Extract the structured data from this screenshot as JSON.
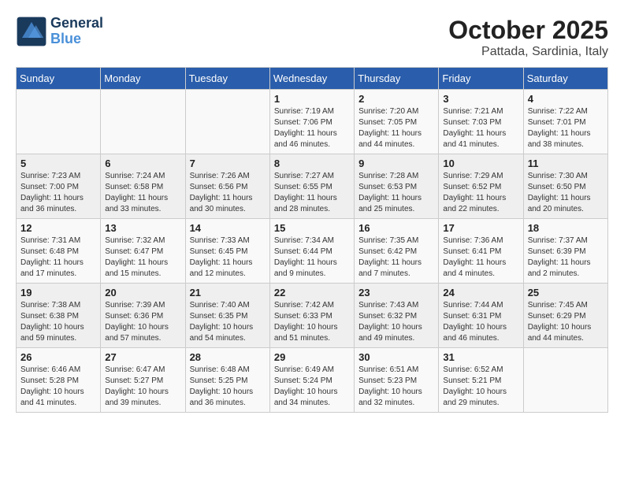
{
  "header": {
    "logo_line1": "General",
    "logo_line2": "Blue",
    "month": "October 2025",
    "location": "Pattada, Sardinia, Italy"
  },
  "weekdays": [
    "Sunday",
    "Monday",
    "Tuesday",
    "Wednesday",
    "Thursday",
    "Friday",
    "Saturday"
  ],
  "weeks": [
    [
      {
        "day": "",
        "info": ""
      },
      {
        "day": "",
        "info": ""
      },
      {
        "day": "",
        "info": ""
      },
      {
        "day": "1",
        "info": "Sunrise: 7:19 AM\nSunset: 7:06 PM\nDaylight: 11 hours\nand 46 minutes."
      },
      {
        "day": "2",
        "info": "Sunrise: 7:20 AM\nSunset: 7:05 PM\nDaylight: 11 hours\nand 44 minutes."
      },
      {
        "day": "3",
        "info": "Sunrise: 7:21 AM\nSunset: 7:03 PM\nDaylight: 11 hours\nand 41 minutes."
      },
      {
        "day": "4",
        "info": "Sunrise: 7:22 AM\nSunset: 7:01 PM\nDaylight: 11 hours\nand 38 minutes."
      }
    ],
    [
      {
        "day": "5",
        "info": "Sunrise: 7:23 AM\nSunset: 7:00 PM\nDaylight: 11 hours\nand 36 minutes."
      },
      {
        "day": "6",
        "info": "Sunrise: 7:24 AM\nSunset: 6:58 PM\nDaylight: 11 hours\nand 33 minutes."
      },
      {
        "day": "7",
        "info": "Sunrise: 7:26 AM\nSunset: 6:56 PM\nDaylight: 11 hours\nand 30 minutes."
      },
      {
        "day": "8",
        "info": "Sunrise: 7:27 AM\nSunset: 6:55 PM\nDaylight: 11 hours\nand 28 minutes."
      },
      {
        "day": "9",
        "info": "Sunrise: 7:28 AM\nSunset: 6:53 PM\nDaylight: 11 hours\nand 25 minutes."
      },
      {
        "day": "10",
        "info": "Sunrise: 7:29 AM\nSunset: 6:52 PM\nDaylight: 11 hours\nand 22 minutes."
      },
      {
        "day": "11",
        "info": "Sunrise: 7:30 AM\nSunset: 6:50 PM\nDaylight: 11 hours\nand 20 minutes."
      }
    ],
    [
      {
        "day": "12",
        "info": "Sunrise: 7:31 AM\nSunset: 6:48 PM\nDaylight: 11 hours\nand 17 minutes."
      },
      {
        "day": "13",
        "info": "Sunrise: 7:32 AM\nSunset: 6:47 PM\nDaylight: 11 hours\nand 15 minutes."
      },
      {
        "day": "14",
        "info": "Sunrise: 7:33 AM\nSunset: 6:45 PM\nDaylight: 11 hours\nand 12 minutes."
      },
      {
        "day": "15",
        "info": "Sunrise: 7:34 AM\nSunset: 6:44 PM\nDaylight: 11 hours\nand 9 minutes."
      },
      {
        "day": "16",
        "info": "Sunrise: 7:35 AM\nSunset: 6:42 PM\nDaylight: 11 hours\nand 7 minutes."
      },
      {
        "day": "17",
        "info": "Sunrise: 7:36 AM\nSunset: 6:41 PM\nDaylight: 11 hours\nand 4 minutes."
      },
      {
        "day": "18",
        "info": "Sunrise: 7:37 AM\nSunset: 6:39 PM\nDaylight: 11 hours\nand 2 minutes."
      }
    ],
    [
      {
        "day": "19",
        "info": "Sunrise: 7:38 AM\nSunset: 6:38 PM\nDaylight: 10 hours\nand 59 minutes."
      },
      {
        "day": "20",
        "info": "Sunrise: 7:39 AM\nSunset: 6:36 PM\nDaylight: 10 hours\nand 57 minutes."
      },
      {
        "day": "21",
        "info": "Sunrise: 7:40 AM\nSunset: 6:35 PM\nDaylight: 10 hours\nand 54 minutes."
      },
      {
        "day": "22",
        "info": "Sunrise: 7:42 AM\nSunset: 6:33 PM\nDaylight: 10 hours\nand 51 minutes."
      },
      {
        "day": "23",
        "info": "Sunrise: 7:43 AM\nSunset: 6:32 PM\nDaylight: 10 hours\nand 49 minutes."
      },
      {
        "day": "24",
        "info": "Sunrise: 7:44 AM\nSunset: 6:31 PM\nDaylight: 10 hours\nand 46 minutes."
      },
      {
        "day": "25",
        "info": "Sunrise: 7:45 AM\nSunset: 6:29 PM\nDaylight: 10 hours\nand 44 minutes."
      }
    ],
    [
      {
        "day": "26",
        "info": "Sunrise: 6:46 AM\nSunset: 5:28 PM\nDaylight: 10 hours\nand 41 minutes."
      },
      {
        "day": "27",
        "info": "Sunrise: 6:47 AM\nSunset: 5:27 PM\nDaylight: 10 hours\nand 39 minutes."
      },
      {
        "day": "28",
        "info": "Sunrise: 6:48 AM\nSunset: 5:25 PM\nDaylight: 10 hours\nand 36 minutes."
      },
      {
        "day": "29",
        "info": "Sunrise: 6:49 AM\nSunset: 5:24 PM\nDaylight: 10 hours\nand 34 minutes."
      },
      {
        "day": "30",
        "info": "Sunrise: 6:51 AM\nSunset: 5:23 PM\nDaylight: 10 hours\nand 32 minutes."
      },
      {
        "day": "31",
        "info": "Sunrise: 6:52 AM\nSunset: 5:21 PM\nDaylight: 10 hours\nand 29 minutes."
      },
      {
        "day": "",
        "info": ""
      }
    ]
  ]
}
